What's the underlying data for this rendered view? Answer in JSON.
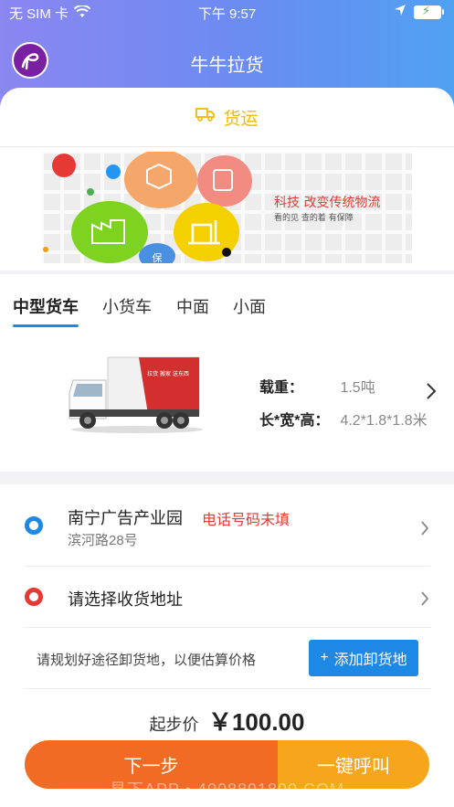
{
  "status_bar": {
    "carrier": "无 SIM 卡",
    "time": "下午 9:57"
  },
  "header": {
    "title": "牛牛拉货"
  },
  "service_tab": {
    "label": "货运"
  },
  "banner": {
    "headline": "科技 改变传统物流",
    "subline": "看的见 查的着 有保障",
    "tag": "保"
  },
  "truck_tabs": [
    "中型货车",
    "小货车",
    "中面",
    "小面"
  ],
  "truck": {
    "load_label": "载重：",
    "load_value": "1.5吨",
    "size_label": "长*宽*高：",
    "size_value": "4.2*1.8*1.8米",
    "side_text": "拉货 搬家 送东西"
  },
  "pickup": {
    "name": "南宁广告产业园",
    "warning": "电话号码未填",
    "detail": "滨河路28号"
  },
  "dropoff": {
    "placeholder": "请选择收货地址"
  },
  "hint": {
    "text": "请规划好途径卸货地，以便估算价格",
    "add_button": "添加卸货地"
  },
  "price": {
    "label": "起步价",
    "amount": "￥100.00"
  },
  "actions": {
    "next": "下一步",
    "call": "一键呼叫"
  },
  "watermark": "易下APP • 4008891800.COM",
  "colors": {
    "accent_blue": "#1e88e5",
    "orange": "#f26b25",
    "yellow": "#f7a51a",
    "warning_red": "#e53935"
  }
}
